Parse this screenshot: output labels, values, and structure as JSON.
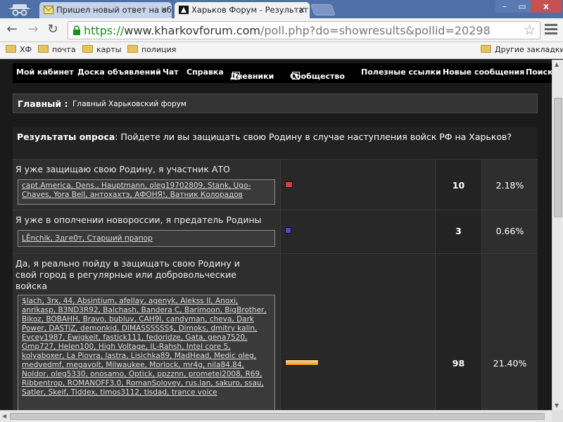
{
  "browser": {
    "tabs": [
      {
        "title": "Пришел новый ответ на об"
      },
      {
        "title": "Харьков Форум - Результат"
      }
    ],
    "tab_close_symbol": "×",
    "window_controls": {
      "minimize": "–",
      "maximize": "▭",
      "close": "x"
    },
    "url": {
      "scheme": "https://",
      "host": "www.kharkovforum.com",
      "path": "/poll.php?do=showresults&pollid=20298"
    },
    "bookmarks": [
      "ХФ",
      "почта",
      "карты",
      "полиция"
    ],
    "other_bookmarks": "Другие закладки"
  },
  "nav": {
    "items": [
      "Мой кабинет",
      "Доска объявлений",
      "Чат",
      "Справка",
      "Дневники",
      "Сообщество",
      "Полезные ссылки",
      "Новые сообщения",
      "Поиск"
    ]
  },
  "breadcrumb": {
    "main": "Главный :",
    "sub": "Главный Харьковский форум"
  },
  "poll": {
    "head_label": "Результаты опроса",
    "question": ": Пойдете ли вы защищать свою Родину в случае наступления войск РФ на Харьков?",
    "options": [
      {
        "text": "Я уже защищаю свою Родину, я участник АТО",
        "voters": "capt.America, Dens., Hauptmann, oleg19702809, Stank, Ugo-Chaves, Yora Bell, антохахтэ, АФОНЯ!, Ватник Колорадов",
        "count": "10",
        "percent": "2.18%",
        "share": 2.18
      },
      {
        "text": "Я уже в ополчении новороссии, я предатель Родины",
        "voters": "LËnchik, Здге0т, Старший прапор",
        "count": "3",
        "percent": "0.66%",
        "share": 0.66
      },
      {
        "text": "Да, я реально пойду в защищать свою Родину и свой город в регулярные или добровольческие войска",
        "voters": "$lach, 3rx, 44, Absintium, afellay, agenyk, Alekss II, Anoxi, anrikasp, B3ND3R92, Balchash, Bandera C, Barimoon, BigBrother, Bikoz, BOBAHH, Bravo, bubluv, CAH9I, candyman, cheva, Dark Power, DASTiZ, demonkid, DIMASSSSSS$, Dimoks, dmitry kalin, Evcey1987, Ewigkeit, fastick111, fedoridze, Gata, gena7520, Gmp727, Helen100, High Voltage, IL-Rahsh, Intel core 5, kolyaboxer, La Piovra, lastra, Lisichka89, MadHead, Medic oleg, medvedmf, megavolt, Milwaukee, Morlock, mr4g, nila84.84, Noldor, oleg5330, onosamo, Optick, ppzznn, prometei2008, R69, Ribbentrop, ROMANOFF3.0, RomanSolovey, rus.lan, sakuro, ssau, Satler, Skeif, Tiddex, timos3112, tisdad, trance voice",
        "count": "98",
        "percent": "21.40%",
        "share": 21.4
      }
    ]
  },
  "icons": [
    "incognito-icon",
    "mail-favicon",
    "forum-favicon",
    "back-icon",
    "forward-icon",
    "reload-icon",
    "lock-icon",
    "star-icon",
    "menu-icon",
    "folder-icon",
    "dropdown-arrow-icon"
  ]
}
